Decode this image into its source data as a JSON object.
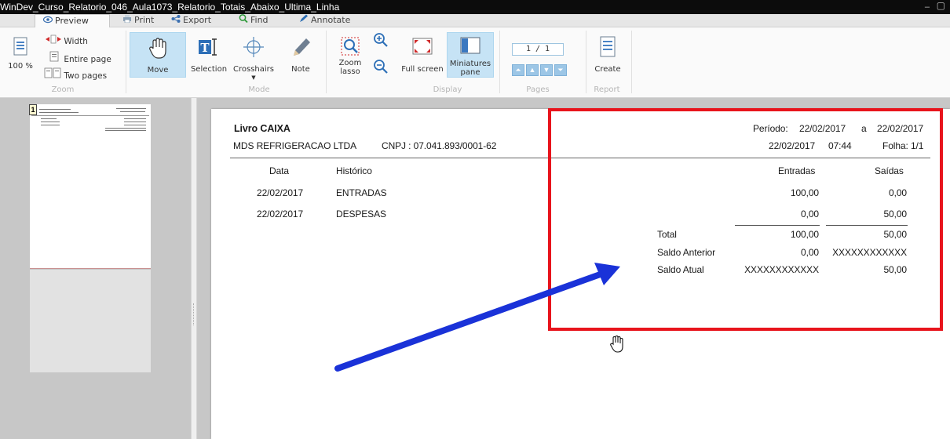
{
  "window": {
    "title": "WinDev_Curso_Relatorio_046_Aula1073_Relatorio_Totais_Abaixo_Ultima_Linha",
    "minimize": "–",
    "maximize": "▢"
  },
  "tabs": [
    {
      "label": "Preview",
      "icon": "eye-icon"
    },
    {
      "label": "Print",
      "icon": "printer-icon"
    },
    {
      "label": "Export",
      "icon": "share-icon"
    },
    {
      "label": "Find",
      "icon": "search-icon"
    },
    {
      "label": "Annotate",
      "icon": "pen-icon"
    }
  ],
  "ribbon": {
    "zoom": {
      "percent": "100 %",
      "width": "Width",
      "entire_page": "Entire page",
      "two_pages": "Two pages",
      "group": "Zoom"
    },
    "mode": {
      "move": "Move",
      "selection": "Selection",
      "crosshairs": "Crosshairs",
      "note": "Note",
      "group": "Mode"
    },
    "display": {
      "zoom_lasso": "Zoom lasso",
      "full_screen": "Full screen",
      "miniatures_pane": "Miniatures pane",
      "group": "Display"
    },
    "pages": {
      "current": "1",
      "total": "/ 1",
      "group": "Pages"
    },
    "report": {
      "create": "Create",
      "group": "Report"
    }
  },
  "thumbnail": {
    "page_number": "1"
  },
  "report": {
    "title": "Livro CAIXA",
    "company": "MDS REFRIGERACAO LTDA",
    "cnpj": "CNPJ : 07.041.893/0001-62",
    "periodo_label": "Período:",
    "periodo_from": "22/02/2017",
    "periodo_a": "a",
    "periodo_to": "22/02/2017",
    "print_date": "22/02/2017",
    "print_time": "07:44",
    "folha": "Folha: 1/1",
    "headers": {
      "data": "Data",
      "historico": "Histórico",
      "entradas": "Entradas",
      "saidas": "Saídas"
    },
    "rows": [
      {
        "data": "22/02/2017",
        "historico": "ENTRADAS",
        "entradas": "100,00",
        "saidas": "0,00"
      },
      {
        "data": "22/02/2017",
        "historico": "DESPESAS",
        "entradas": "0,00",
        "saidas": "50,00"
      }
    ],
    "totals": [
      {
        "label": "Total",
        "entradas": "100,00",
        "saidas": "50,00"
      },
      {
        "label": "Saldo Anterior",
        "entradas": "0,00",
        "saidas": "XXXXXXXXXXXX"
      },
      {
        "label": "Saldo Atual",
        "entradas": "XXXXXXXXXXXX",
        "saidas": "50,00"
      }
    ]
  },
  "annotations": {
    "highlight_color": "#e8141c",
    "arrow_color": "#1a32d8"
  },
  "cursor": {
    "icon": "hand-cursor-icon"
  }
}
